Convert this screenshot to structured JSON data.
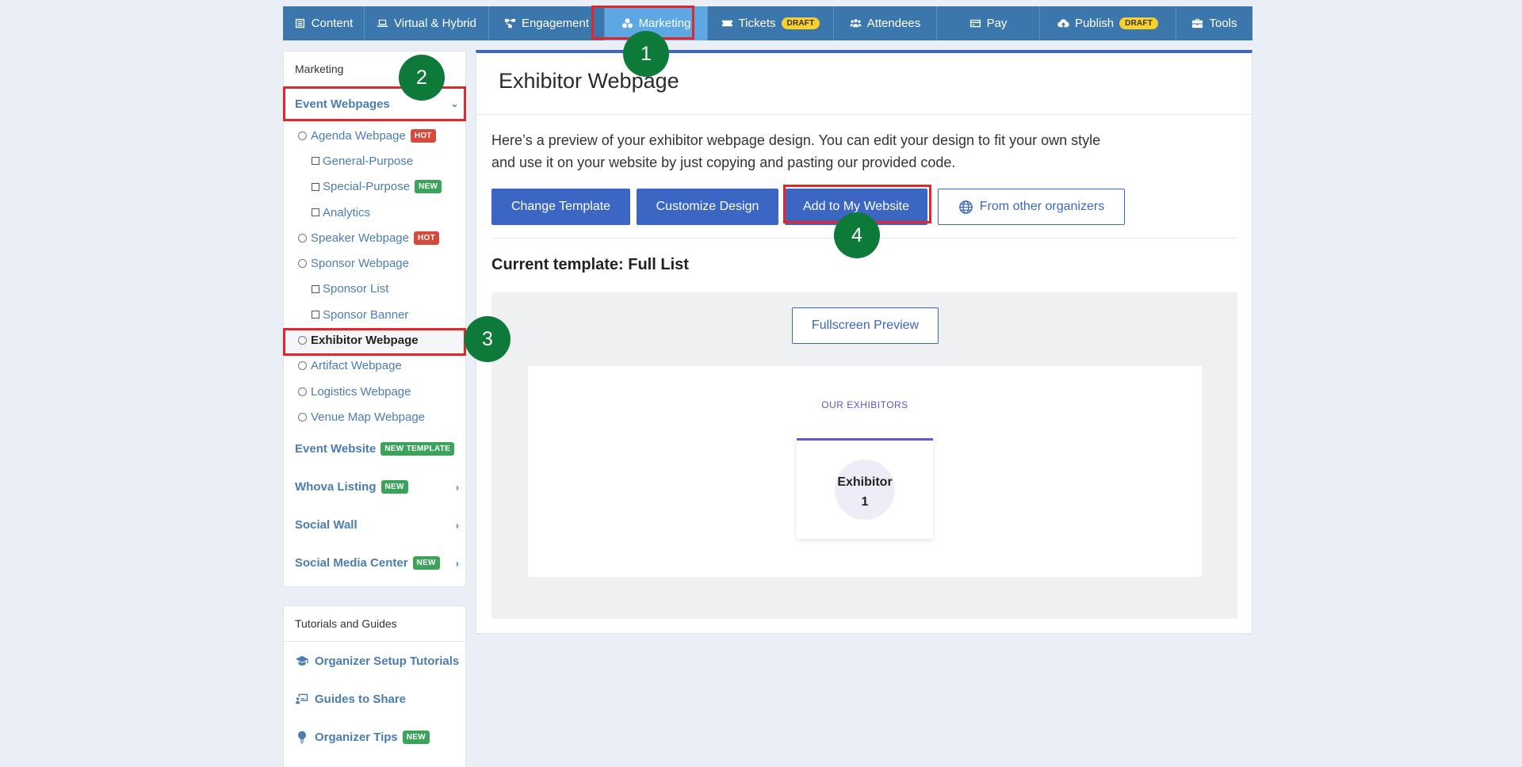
{
  "topnav": {
    "items": [
      {
        "label": "Content",
        "icon": "content-icon"
      },
      {
        "label": "Virtual & Hybrid",
        "icon": "laptop-icon"
      },
      {
        "label": "Engagement",
        "icon": "engagement-icon"
      },
      {
        "label": "Marketing",
        "icon": "marketing-icon",
        "active": true
      },
      {
        "label": "Tickets",
        "icon": "ticket-icon",
        "badge": "DRAFT"
      },
      {
        "label": "Attendees",
        "icon": "attendees-icon"
      },
      {
        "label": "Pay",
        "icon": "card-icon"
      },
      {
        "label": "Publish",
        "icon": "cloud-upload-icon",
        "badge": "DRAFT"
      },
      {
        "label": "Tools",
        "icon": "toolbox-icon"
      }
    ]
  },
  "sidebar": {
    "heading": "Marketing",
    "event_webpages": {
      "label": "Event Webpages",
      "items": [
        {
          "label": "Agenda Webpage",
          "badge": "HOT"
        },
        {
          "label": "General-Purpose"
        },
        {
          "label": "Special-Purpose",
          "badge": "NEW"
        },
        {
          "label": "Analytics"
        },
        {
          "label": "Speaker Webpage",
          "badge": "HOT"
        },
        {
          "label": "Sponsor Webpage"
        },
        {
          "label": "Sponsor List"
        },
        {
          "label": "Sponsor Banner"
        },
        {
          "label": "Exhibitor Webpage",
          "selected": true
        },
        {
          "label": "Artifact Webpage"
        },
        {
          "label": "Logistics Webpage"
        },
        {
          "label": "Venue Map Webpage"
        }
      ]
    },
    "event_website": {
      "label": "Event Website",
      "badge": "NEW TEMPLATE"
    },
    "whova_listing": {
      "label": "Whova Listing",
      "badge": "NEW"
    },
    "social_wall": {
      "label": "Social Wall"
    },
    "social_media_center": {
      "label": "Social Media Center",
      "badge": "NEW"
    }
  },
  "tutorials": {
    "heading": "Tutorials and Guides",
    "items": [
      {
        "label": "Organizer Setup Tutorials"
      },
      {
        "label": "Guides to Share"
      },
      {
        "label": "Organizer Tips",
        "badge": "NEW"
      }
    ]
  },
  "main": {
    "title": "Exhibitor Webpage",
    "description": "Here’s a preview of your exhibitor webpage design. You can edit your design to fit your own style and use it on your website by just copying and pasting our provided code.",
    "buttons": {
      "change_template": "Change Template",
      "customize_design": "Customize Design",
      "add_to_website": "Add to My Website",
      "from_other": "From other organizers"
    },
    "current_template": "Current template: Full List",
    "fullscreen_preview": "Fullscreen Preview",
    "preview": {
      "section_label": "OUR EXHIBITORS",
      "exhibitor_name": "Exhibitor",
      "exhibitor_number": "1"
    }
  },
  "annotations": {
    "step1": "1",
    "step2": "2",
    "step3": "3",
    "step4": "4"
  },
  "colors": {
    "nav": "#3b77ad",
    "nav_active": "#5da8e3",
    "primary": "#3b66c4",
    "highlight": "#e3262b",
    "step": "#0e7a3a"
  }
}
